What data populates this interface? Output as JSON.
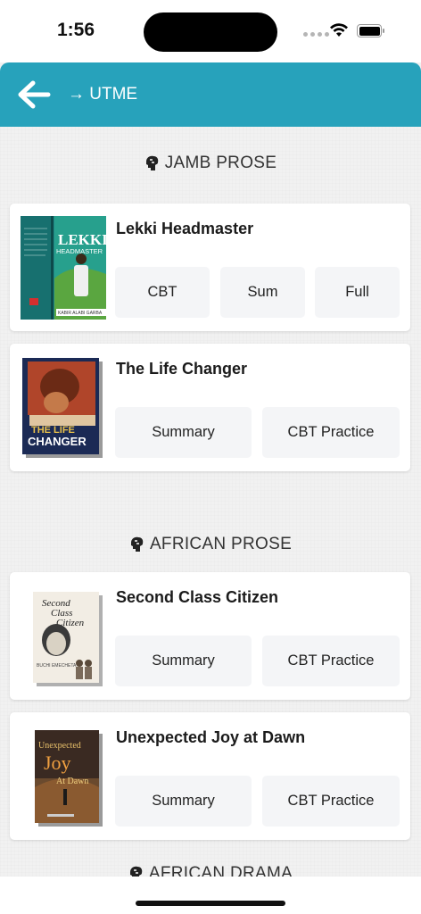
{
  "status_bar": {
    "time": "1:56"
  },
  "header": {
    "breadcrumb": "→ UTME"
  },
  "sections": [
    {
      "title": "JAMB PROSE",
      "books": [
        {
          "title": "Lekki Headmaster",
          "buttons": [
            "CBT",
            "Sum",
            "Full"
          ],
          "cover_text": [
            "LEKKI",
            "HEADMASTER",
            "KABIR ALABI GARBA"
          ]
        },
        {
          "title": "The Life Changer",
          "buttons": [
            "Summary",
            "CBT Practice"
          ],
          "cover_text": [
            "THE LIFE",
            "CHANGER"
          ]
        }
      ]
    },
    {
      "title": "AFRICAN PROSE",
      "books": [
        {
          "title": "Second Class Citizen",
          "buttons": [
            "Summary",
            "CBT Practice"
          ],
          "cover_text": [
            "Second",
            "Class",
            "Citizen",
            "BUCHI EMECHETA"
          ]
        },
        {
          "title": "Unexpected Joy at Dawn",
          "buttons": [
            "Summary",
            "CBT Practice"
          ],
          "cover_text": [
            "Unexpected",
            "Joy",
            "At Dawn"
          ]
        }
      ]
    },
    {
      "title": "AFRICAN DRAMA"
    }
  ],
  "colors": {
    "header": "#27a2bb",
    "button_bg": "#f4f5f7",
    "background": "#f1f1f1"
  }
}
